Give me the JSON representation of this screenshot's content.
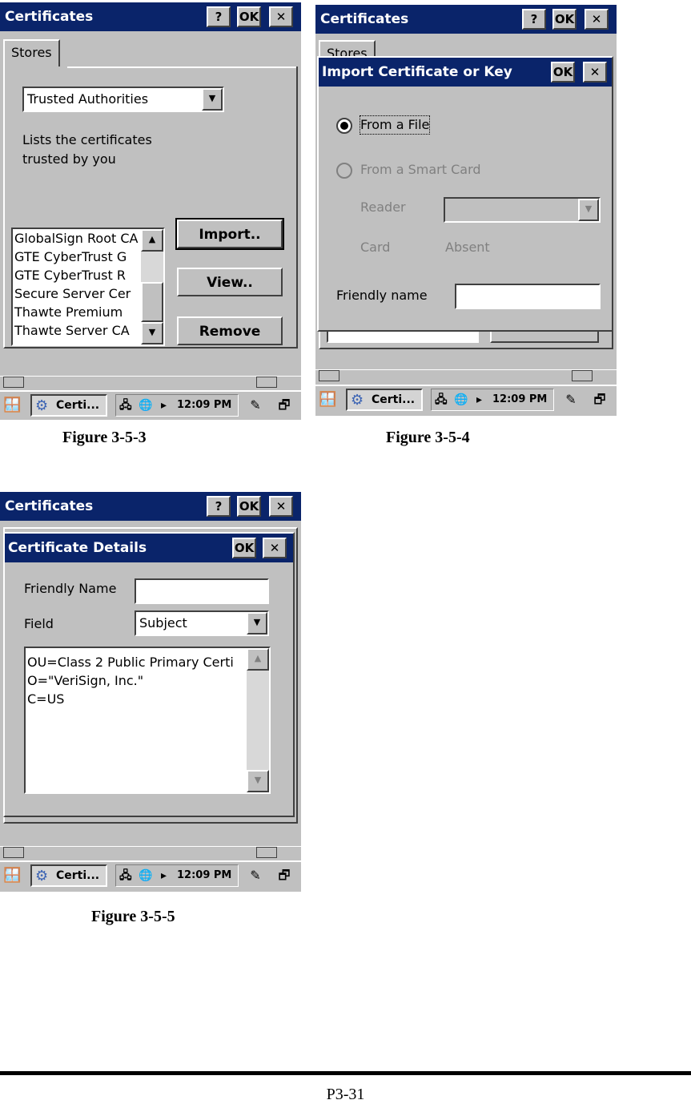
{
  "common": {
    "title": "Certificates",
    "help_label": "?",
    "ok_label": "OK",
    "close_label": "✕",
    "tab_stores": "Stores",
    "task_label": "Certi...",
    "clock": "12:09 PM"
  },
  "fig3": {
    "store_select": "Trusted Authorities",
    "description_line1": "Lists the certificates",
    "description_line2": "trusted by you",
    "cert_list": [
      "GlobalSign Root CA",
      "GTE CyberTrust G",
      "GTE CyberTrust R",
      "Secure Server Cer",
      "Thawte Premium",
      "Thawte Server CA"
    ],
    "import_label": "Import..",
    "view_label": "View..",
    "remove_label": "Remove",
    "caption": "Figure 3-5-3"
  },
  "fig4": {
    "dialog_title": "Import Certificate or Key",
    "from_file": "From a File",
    "from_card": "From a Smart Card",
    "reader_label": "Reader",
    "card_label": "Card",
    "card_value": "Absent",
    "friendly_label": "Friendly name",
    "caption": "Figure 3-5-4"
  },
  "fig5": {
    "dialog_title": "Certificate Details",
    "friendly_label": "Friendly Name",
    "field_label": "Field",
    "field_value": "Subject",
    "details": [
      "OU=Class 2 Public Primary Certi",
      "O=\"VeriSign, Inc.\"",
      "C=US"
    ],
    "caption": "Figure 3-5-5"
  },
  "page_number": "P3-31"
}
